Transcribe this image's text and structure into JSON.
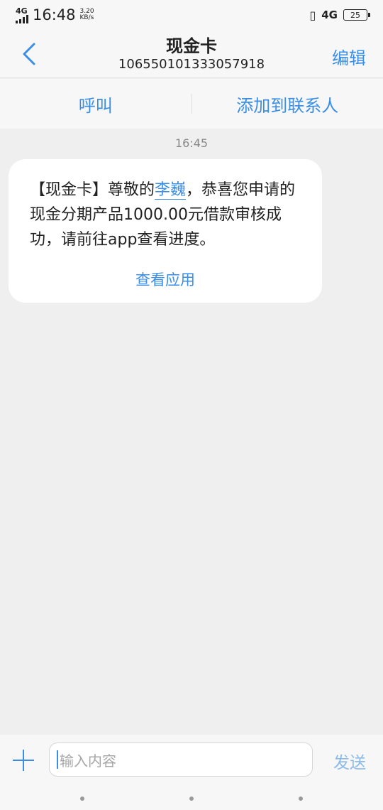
{
  "status_bar": {
    "network_type": "4G",
    "time": "16:48",
    "speed_value": "3.20",
    "speed_unit": "KB/s",
    "right_network": "4G",
    "battery": "25"
  },
  "header": {
    "title": "现金卡",
    "subtitle": "106550101333057918",
    "edit_label": "编辑"
  },
  "actions": {
    "call_label": "呼叫",
    "add_contact_label": "添加到联系人"
  },
  "conversation": {
    "timestamp": "16:45",
    "message_part1": "【现金卡】尊敬的",
    "message_name": "李巍",
    "message_part2": "，恭喜您申请的现金分期产品1000.00元借款审核成功，请前往app查看进度。",
    "view_app_label": "查看应用"
  },
  "composer": {
    "placeholder": "输入内容",
    "send_label": "发送"
  },
  "colors": {
    "accent": "#3a8ee6",
    "background": "#efefef",
    "bubble": "#ffffff"
  }
}
